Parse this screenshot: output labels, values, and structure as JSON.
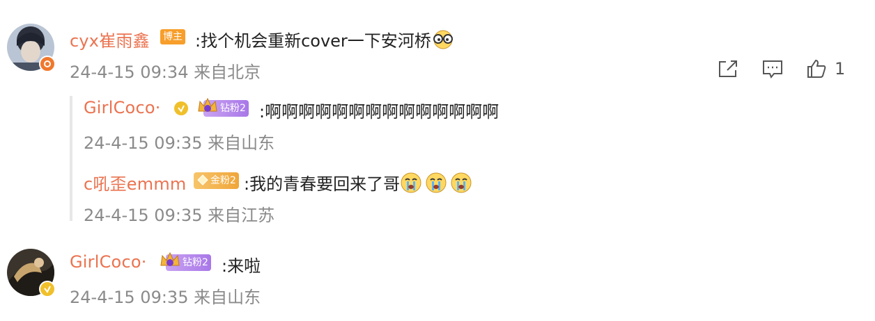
{
  "comments": [
    {
      "username": "cyx崔雨鑫",
      "role_badge": "博主",
      "text": ":找个机会重新cover一下安河桥",
      "emoji": "glasses-face",
      "time": "24-4-15 09:34",
      "location": "来自北京",
      "like_count": "1",
      "verified_color": "#f0782d"
    },
    {
      "username": "GirlCoco·",
      "fan_badge": "钻粉2",
      "text": ":来啦",
      "time": "24-4-15 09:35",
      "location": "来自山东",
      "verified_color": "#f0c02b"
    }
  ],
  "replies": [
    {
      "username": "GirlCoco·",
      "fan_badge": "钻粉2",
      "text": ":啊啊啊啊啊啊啊啊啊啊啊啊啊啊",
      "time": "24-4-15 09:35",
      "location": "来自山东"
    },
    {
      "username": "c吼歪emmm",
      "fan_badge": "金粉2",
      "text": ":我的青春要回来了哥",
      "emoji": "crying-face",
      "time": "24-4-15 09:35",
      "location": "来自江苏"
    }
  ],
  "colors": {
    "username": "#eb7350",
    "meta": "#8a8a8a",
    "icon": "#555555"
  }
}
